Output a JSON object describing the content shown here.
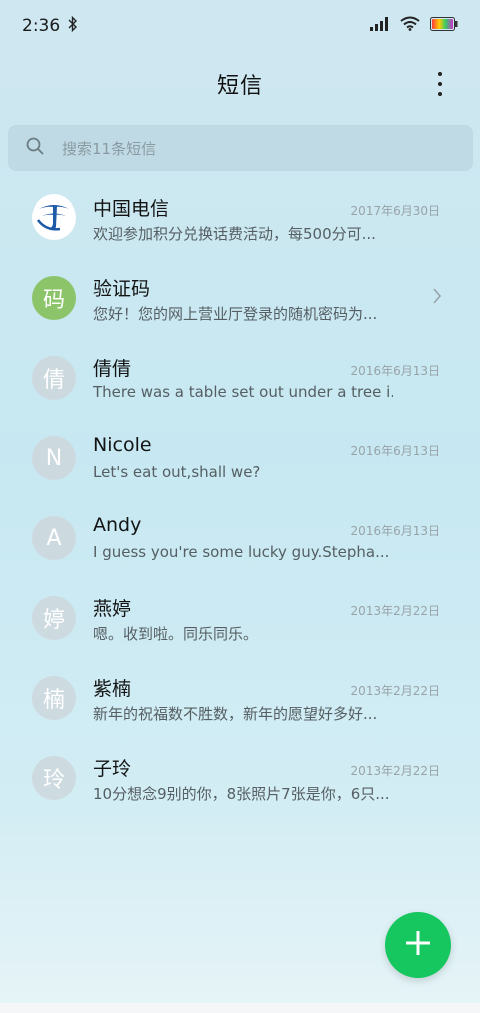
{
  "status_bar": {
    "time": "2:36"
  },
  "header": {
    "title": "短信"
  },
  "search": {
    "placeholder": "搜索11条短信"
  },
  "conversations": [
    {
      "name": "中国电信",
      "preview": "欢迎参加积分兑换话费活动，每500分可...",
      "date": "2017年6月30日",
      "avatar": ""
    },
    {
      "name": "验证码",
      "preview": "您好！您的网上营业厅登录的随机密码为...",
      "date": "",
      "avatar": "码"
    },
    {
      "name": "倩倩",
      "preview": "There was a table set out under a tree i...",
      "date": "2016年6月13日",
      "avatar": "倩"
    },
    {
      "name": "Nicole",
      "preview": "Let's eat out,shall we?",
      "date": "2016年6月13日",
      "avatar": "N"
    },
    {
      "name": "Andy",
      "preview": "I guess you're some lucky guy.Stepha...",
      "date": "2016年6月13日",
      "avatar": "A"
    },
    {
      "name": "燕婷",
      "preview": "嗯。收到啦。同乐同乐。",
      "date": "2013年2月22日",
      "avatar": "婷"
    },
    {
      "name": "紫楠",
      "preview": "新年的祝福数不胜数，新年的愿望好多好...",
      "date": "2013年2月22日",
      "avatar": "楠"
    },
    {
      "name": "子玲",
      "preview": "10分想念9别的你，8张照片7张是你，6只...",
      "date": "2013年2月22日",
      "avatar": "玲"
    }
  ],
  "colors": {
    "accent": "#16c65e",
    "code_avatar": "#8cc46a",
    "telecom_blue": "#1f5aa8"
  }
}
